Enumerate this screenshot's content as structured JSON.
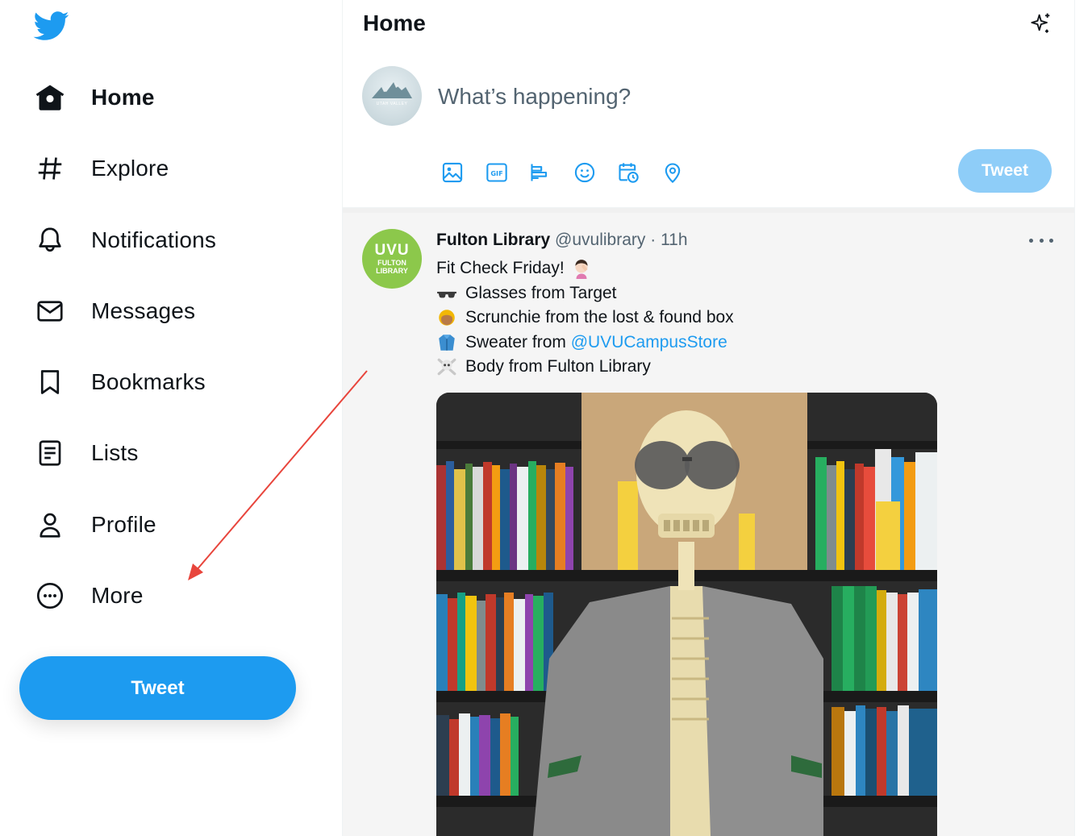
{
  "sidebar": {
    "logo": "twitter-bird-icon",
    "items": [
      {
        "label": "Home",
        "icon": "home-icon",
        "active": true
      },
      {
        "label": "Explore",
        "icon": "hashtag-icon"
      },
      {
        "label": "Notifications",
        "icon": "bell-icon"
      },
      {
        "label": "Messages",
        "icon": "envelope-icon"
      },
      {
        "label": "Bookmarks",
        "icon": "bookmark-icon"
      },
      {
        "label": "Lists",
        "icon": "list-icon"
      },
      {
        "label": "Profile",
        "icon": "person-icon"
      },
      {
        "label": "More",
        "icon": "more-circle-icon"
      }
    ],
    "tweet_label": "Tweet"
  },
  "header": {
    "title": "Home",
    "sparkle_icon": "sparkle-icon"
  },
  "composer": {
    "avatar_text": "UTAH VALLEY",
    "placeholder": "What’s happening?",
    "tools": [
      "image-icon",
      "gif-icon",
      "poll-icon",
      "emoji-icon",
      "schedule-icon",
      "location-icon"
    ],
    "gif_text": "GIF",
    "tweet_label": "Tweet"
  },
  "tweet": {
    "avatar_line1": "UVU",
    "avatar_line2": "FULTON",
    "avatar_line3": "LIBRARY",
    "name": "Fulton Library",
    "handle": "@uvulibrary",
    "separator": "·",
    "time": "11h",
    "lines": [
      {
        "emoji": "🤦",
        "text": "Fit Check Friday!"
      },
      {
        "emoji": "🕶",
        "text": "Glasses from Target"
      },
      {
        "emoji": "👱",
        "text": "Scrunchie from the lost & found box"
      },
      {
        "emoji": "🧥",
        "text_before": "Sweater from ",
        "link": "@UVUCampusStore"
      },
      {
        "emoji": "☠",
        "text": "Body from Fulton Library"
      }
    ],
    "media_description": "skeleton-in-library-photo"
  },
  "colors": {
    "accent": "#1d9bf0",
    "accent_disabled": "#8ecdf8",
    "annotation_arrow": "#e8453c",
    "uvu_green": "#8cc84b"
  }
}
